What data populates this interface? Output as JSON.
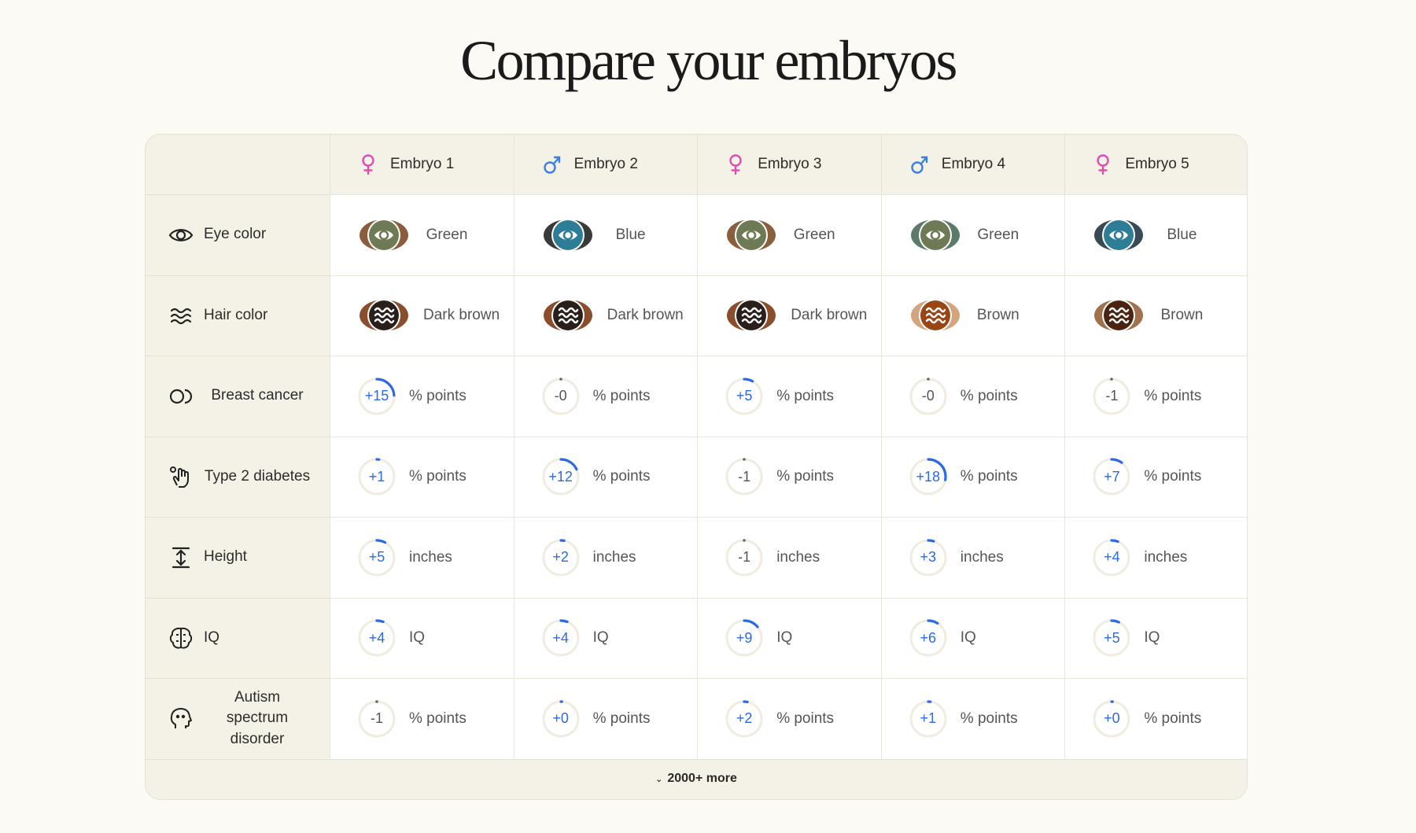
{
  "title": "Compare your embryos",
  "embryos": [
    {
      "label": "Embryo 1",
      "sex": "female"
    },
    {
      "label": "Embryo 2",
      "sex": "male"
    },
    {
      "label": "Embryo 3",
      "sex": "female"
    },
    {
      "label": "Embryo 4",
      "sex": "male"
    },
    {
      "label": "Embryo 5",
      "sex": "female"
    }
  ],
  "colors": {
    "female": "#e24db2",
    "male": "#3b7fe0",
    "gauge_blue": "#2a6ae6"
  },
  "rows": [
    {
      "label": "Eye color",
      "icon": "eye-icon",
      "kind": "swatch",
      "cells": [
        {
          "text": "Green",
          "color": "#6e7a55",
          "ring": "#8a5e3c"
        },
        {
          "text": "Blue",
          "color": "#2e7d97",
          "ring": "#3a3a3a"
        },
        {
          "text": "Green",
          "color": "#6e7a55",
          "ring": "#8a5e3c"
        },
        {
          "text": "Green",
          "color": "#6e7a55",
          "ring": "#5a7a6a"
        },
        {
          "text": "Blue",
          "color": "#2e7d97",
          "ring": "#3a4a55"
        }
      ]
    },
    {
      "label": "Hair color",
      "icon": "waves-icon",
      "kind": "swatch",
      "cells": [
        {
          "text": "Dark brown",
          "color": "#2a1f1b",
          "ring": "#8a4e2c"
        },
        {
          "text": "Dark brown",
          "color": "#2a1f1b",
          "ring": "#8a4e2c"
        },
        {
          "text": "Dark brown",
          "color": "#2a1f1b",
          "ring": "#8a4e2c"
        },
        {
          "text": "Brown",
          "color": "#9a4515",
          "ring": "#d2a57f"
        },
        {
          "text": "Brown",
          "color": "#4a2410",
          "ring": "#a0714d"
        }
      ]
    },
    {
      "label": "Breast cancer",
      "icon": "breast-icon",
      "kind": "gauge",
      "unit": "% points",
      "cells": [
        {
          "value": "+15",
          "fill": 0.24
        },
        {
          "value": "-0",
          "fill": 0.0
        },
        {
          "value": "+5",
          "fill": 0.08
        },
        {
          "value": "-0",
          "fill": 0.0
        },
        {
          "value": "-1",
          "fill": 0.0
        }
      ]
    },
    {
      "label": "Type 2 diabetes",
      "icon": "hand-icon",
      "kind": "gauge",
      "unit": "% points",
      "cells": [
        {
          "value": "+1",
          "fill": 0.02
        },
        {
          "value": "+12",
          "fill": 0.18
        },
        {
          "value": "-1",
          "fill": 0.0
        },
        {
          "value": "+18",
          "fill": 0.28
        },
        {
          "value": "+7",
          "fill": 0.1
        }
      ]
    },
    {
      "label": "Height",
      "icon": "height-icon",
      "kind": "gauge",
      "unit": "inches",
      "cells": [
        {
          "value": "+5",
          "fill": 0.08
        },
        {
          "value": "+2",
          "fill": 0.03
        },
        {
          "value": "-1",
          "fill": 0.0
        },
        {
          "value": "+3",
          "fill": 0.05
        },
        {
          "value": "+4",
          "fill": 0.06
        }
      ]
    },
    {
      "label": "IQ",
      "icon": "brain-icon",
      "kind": "gauge",
      "unit": "IQ",
      "cells": [
        {
          "value": "+4",
          "fill": 0.06
        },
        {
          "value": "+4",
          "fill": 0.06
        },
        {
          "value": "+9",
          "fill": 0.14
        },
        {
          "value": "+6",
          "fill": 0.09
        },
        {
          "value": "+5",
          "fill": 0.07
        }
      ]
    },
    {
      "label": "Autism spectrum disorder",
      "icon": "head-icon",
      "kind": "gauge",
      "unit": "% points",
      "cells": [
        {
          "value": "-1",
          "fill": 0.0
        },
        {
          "value": "+0",
          "fill": 0.01
        },
        {
          "value": "+2",
          "fill": 0.03
        },
        {
          "value": "+1",
          "fill": 0.02
        },
        {
          "value": "+0",
          "fill": 0.01
        }
      ]
    }
  ],
  "footer": {
    "label": "2000+ more",
    "icon": "chevron-down-icon"
  }
}
